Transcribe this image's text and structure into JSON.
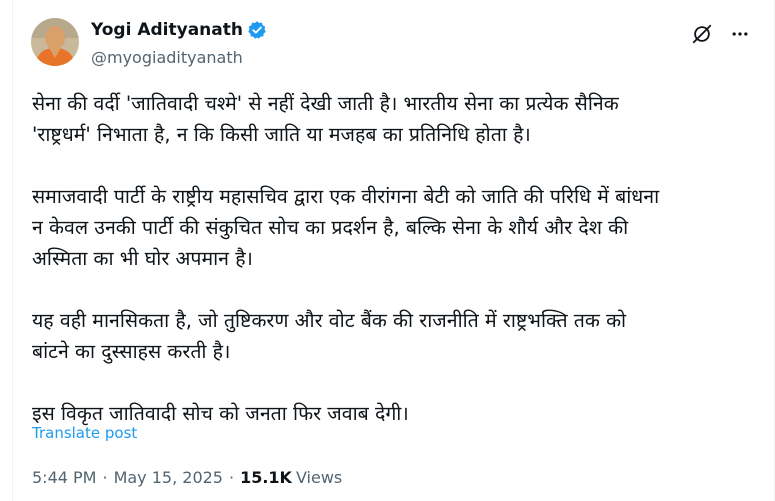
{
  "author": {
    "display_name": "Yogi Adityanath",
    "handle": "@myogiadityanath",
    "verified_color": "#1d9bf0"
  },
  "actions": {
    "grok_icon": "grok-icon",
    "more_icon": "more-icon"
  },
  "post": {
    "paragraphs": [
      "सेना की वर्दी 'जातिवादी चश्मे' से नहीं देखी जाती है। भारतीय सेना का प्रत्येक सैनिक\n'राष्ट्रधर्म' निभाता है, न कि किसी जाति या मजहब का प्रतिनिधि होता है।",
      "समाजवादी पार्टी के राष्ट्रीय महासचिव द्वारा एक वीरांगना बेटी को जाति की परिधि में बांधना\nन केवल उनकी पार्टी की संकुचित सोच का प्रदर्शन है, बल्कि सेना के शौर्य और देश की\nअस्मिता का भी घोर अपमान है।",
      "यह वही मानसिकता है, जो तुष्टिकरण और वोट बैंक की राजनीति में राष्ट्रभक्ति तक को\nबांटने का दुस्साहस करती है।",
      "इस विकृत जातिवादी सोच को जनता फिर जवाब देगी।"
    ],
    "translate_label": "Translate post",
    "time": "5:44 PM",
    "date": "May 15, 2025",
    "views_count": "15.1K",
    "views_label": "Views",
    "separator": "·"
  }
}
